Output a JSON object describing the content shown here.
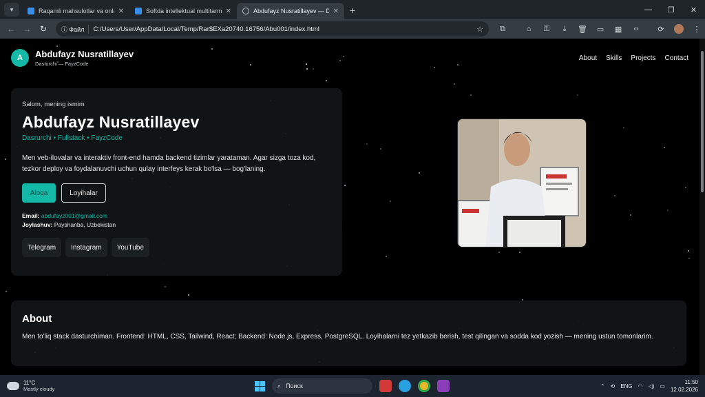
{
  "browser": {
    "tabs": [
      {
        "title": "Raqamli mahsulotlar va onlayn"
      },
      {
        "title": "Softda intellektual multitarmoq"
      },
      {
        "title": "Abdufayz Nusratillayev — Das"
      }
    ],
    "address": {
      "info": "Файл",
      "url": "C:/Users/User/AppData/Local/Temp/Rar$EXa20740.16756/Abu001/index.html"
    }
  },
  "site": {
    "logo_letter": "A",
    "brand_name": "Abdufayz Nusratillayev",
    "brand_sub": "Dasturchi — FayzCode",
    "nav": [
      "About",
      "Skills",
      "Projects",
      "Contact"
    ],
    "hero": {
      "greeting": "Salom, mening ismim",
      "name": "Abdufayz Nusratillayev",
      "role": "Dasrurchi • Fullstack • FayzCode",
      "description": "Men veb-ilovalar va interaktiv front-end hamda backend tizimlar yarataman. Agar sizga toza kod, tezkor deploy va foydalanuvchi uchun qulay interfeys kerak bo'lsa — bog'laning.",
      "btn_primary": "Aloqa",
      "btn_secondary": "Loyihalar",
      "email_label": "Email:",
      "email": "abdufayz001@gmail.com",
      "location_label": "Joylashuv:",
      "location": "Payshanba, Uzbekistan",
      "social": [
        "Telegram",
        "Instagram",
        "YouTube"
      ]
    },
    "about": {
      "title": "About",
      "text": "Men to'liq stack dasturchiman. Frontend: HTML, CSS, Tailwind, React; Backend: Node.js, Express, PostgreSQL. Loyihalarni tez yetkazib berish, test qilingan va sodda kod yozish — mening ustun tomonlarim."
    }
  },
  "taskbar": {
    "temp": "11°C",
    "weather": "Mostly cloudy",
    "search_placeholder": "Поиск",
    "lang": "ENG",
    "time": "11:50",
    "date": "12.02.2026"
  },
  "colors": {
    "accent": "#14b8a6",
    "background": "#000000",
    "card": "#121618"
  }
}
